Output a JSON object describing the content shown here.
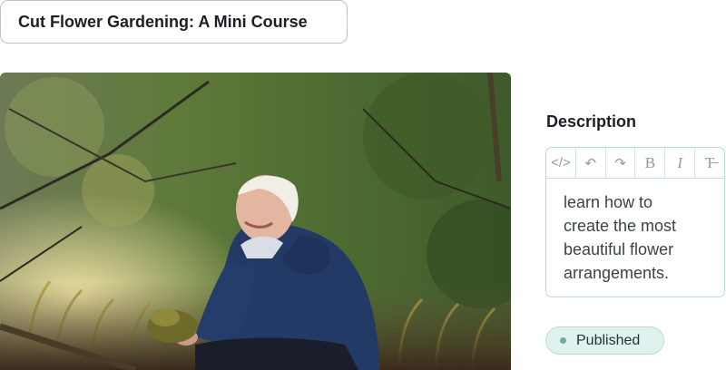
{
  "course": {
    "title": "Cut Flower Gardening: A Mini Course"
  },
  "description": {
    "label": "Description",
    "text": "learn how to\ncreate the most\nbeautiful flower\narrangements.",
    "toolbar": [
      {
        "icon": "code-icon",
        "glyph": "</>"
      },
      {
        "icon": "undo-icon",
        "glyph": "↶"
      },
      {
        "icon": "redo-icon",
        "glyph": "↷"
      },
      {
        "icon": "bold-icon",
        "glyph": "B"
      },
      {
        "icon": "italic-icon",
        "glyph": "I"
      },
      {
        "icon": "strikethrough-icon",
        "glyph": "T̶"
      }
    ]
  },
  "status": {
    "label": "Published",
    "color": "#7aa79b"
  }
}
